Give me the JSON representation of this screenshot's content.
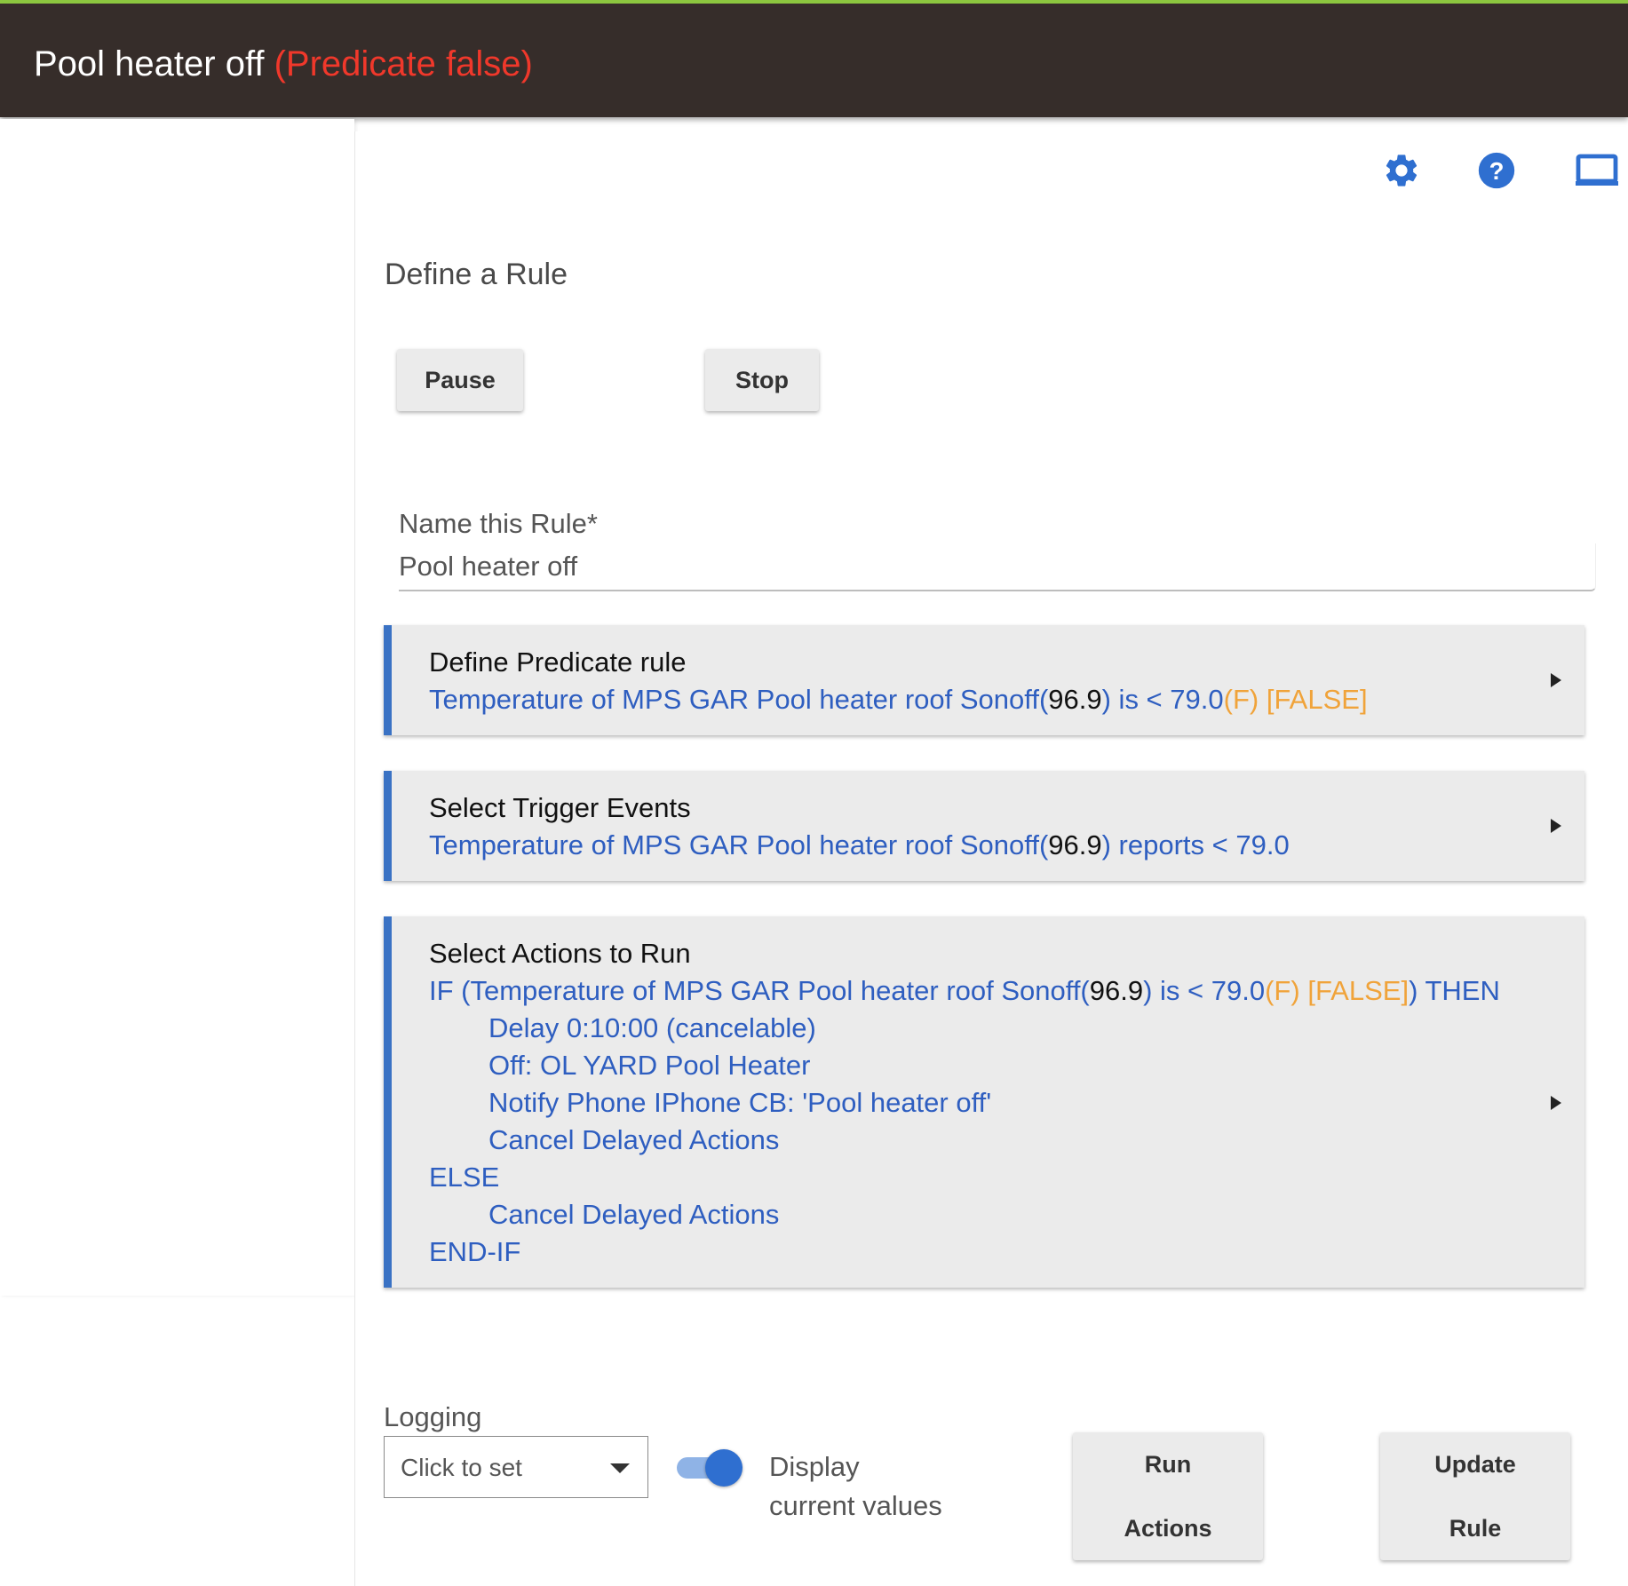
{
  "header": {
    "title": "Pool heater off",
    "status": "(Predicate false)"
  },
  "toolbar": {
    "icons": [
      "gear-icon",
      "help-icon",
      "window-icon"
    ]
  },
  "page": {
    "heading": "Define a Rule"
  },
  "controls": {
    "pause_label": "Pause",
    "stop_label": "Stop"
  },
  "name_field": {
    "label": "Name this Rule*",
    "value": "Pool heater off"
  },
  "sections": {
    "predicate": {
      "title": "Define Predicate rule",
      "device": "Temperature of MPS GAR Pool heater roof Sonoff(",
      "value": "96.9",
      "cond": ") is < 79.0",
      "unit": "(F)",
      "state": "[FALSE]"
    },
    "triggers": {
      "title": "Select Trigger Events",
      "device": "Temperature of MPS GAR Pool heater roof Sonoff(",
      "value": "96.9",
      "cond": ") reports < 79.0"
    },
    "actions": {
      "title": "Select Actions to Run",
      "if_prefix": "IF (Temperature of MPS GAR Pool heater roof Sonoff(",
      "if_value": "96.9",
      "if_cond": ") is < 79.0",
      "if_unit": "(F)",
      "if_state": "[FALSE]",
      "if_suffix": ") THEN",
      "then_items": [
        "Delay 0:10:00 (cancelable)",
        "Off: OL YARD Pool Heater",
        "Notify Phone IPhone CB: 'Pool heater off'",
        "Cancel Delayed Actions"
      ],
      "else_label": "ELSE",
      "else_items": [
        "Cancel Delayed Actions"
      ],
      "end_label": "END-IF"
    }
  },
  "footer": {
    "logging_label": "Logging",
    "logging_value": "Click to set",
    "toggle_line1": "Display",
    "toggle_line2": "current values",
    "toggle_on": true,
    "run_line1": "Run",
    "run_line2": "Actions",
    "update_line1": "Update",
    "update_line2": "Rule"
  },
  "colors": {
    "header_bg": "#362d2a",
    "header_accent": "#8cc63f",
    "status_red": "#f0382b",
    "link_blue": "#2e5ec0",
    "state_orange": "#f0a33a",
    "section_border": "#3a72c4"
  }
}
